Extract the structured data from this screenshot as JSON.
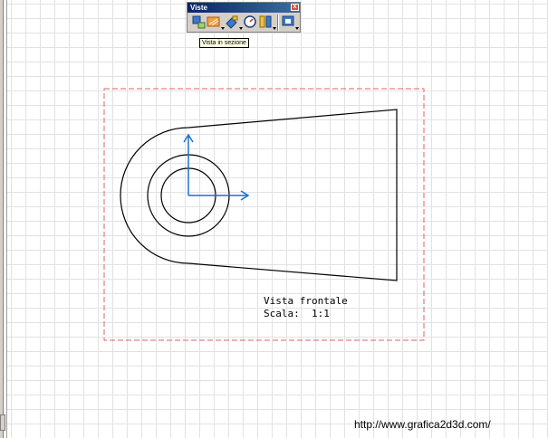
{
  "toolbar": {
    "title": "Viste",
    "close_label": "x",
    "buttons": [
      {
        "name": "viste-proiettate-icon"
      },
      {
        "name": "vista-in-sezione-icon"
      },
      {
        "name": "vista-ausiliaria-icon"
      },
      {
        "name": "vista-di-dettaglio-icon"
      },
      {
        "name": "vista-interrotta-icon"
      },
      {
        "name": "vista-avanzata-icon"
      }
    ]
  },
  "tooltip": {
    "text": "Vista in sezione"
  },
  "view": {
    "name": "Vista frontale",
    "scale": "Scala:  1:1",
    "frame_color": "#e06060",
    "axis_color": "#1e6fd0"
  },
  "watermark": "http://www.grafica2d3d.com/"
}
